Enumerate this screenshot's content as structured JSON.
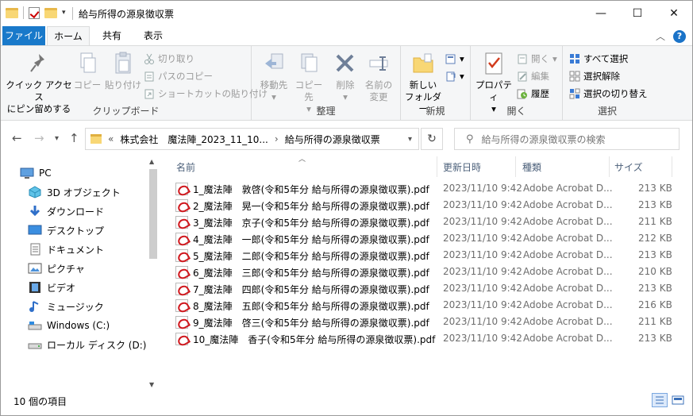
{
  "window": {
    "title": "給与所得の源泉徴収票",
    "minimize": "—",
    "maximize": "☐",
    "close": "✕"
  },
  "tabs": {
    "file": "ファイル",
    "home": "ホーム",
    "share": "共有",
    "view": "表示",
    "help": "?"
  },
  "ribbon": {
    "clipboard": {
      "label": "クリップボード",
      "pin": "クイック アクセス\nにピン留めする",
      "copy": "コピー",
      "paste": "貼り付け",
      "cut": "切り取り",
      "copy_path": "パスのコピー",
      "paste_shortcut": "ショートカットの貼り付け"
    },
    "organize": {
      "label": "整理",
      "move_to": "移動先",
      "copy_to": "コピー先",
      "delete": "削除",
      "rename": "名前の\n変更"
    },
    "new": {
      "label": "新規",
      "new_folder": "新しい\nフォルダー"
    },
    "open": {
      "label": "開く",
      "properties": "プロパティ",
      "open": "開く",
      "edit": "編集",
      "history": "履歴"
    },
    "select": {
      "label": "選択",
      "select_all": "すべて選択",
      "select_none": "選択解除",
      "invert": "選択の切り替え"
    }
  },
  "address": {
    "prefix": "«",
    "crumb1": "株式会社　魔法陣_2023_11_10...",
    "sep": "›",
    "crumb2": "給与所得の源泉徴収票",
    "search_placeholder": "給与所得の源泉徴収票の検索"
  },
  "nav": [
    {
      "label": "PC",
      "icon": "pc-icon",
      "indent": 0
    },
    {
      "label": "3D オブジェクト",
      "icon": "3d-objects-icon",
      "indent": 1
    },
    {
      "label": "ダウンロード",
      "icon": "download-icon",
      "indent": 1
    },
    {
      "label": "デスクトップ",
      "icon": "desktop-icon",
      "indent": 1
    },
    {
      "label": "ドキュメント",
      "icon": "documents-icon",
      "indent": 1
    },
    {
      "label": "ピクチャ",
      "icon": "pictures-icon",
      "indent": 1
    },
    {
      "label": "ビデオ",
      "icon": "video-icon",
      "indent": 1
    },
    {
      "label": "ミュージック",
      "icon": "music-icon",
      "indent": 1
    },
    {
      "label": "Windows (C:)",
      "icon": "drive-c-icon",
      "indent": 1
    },
    {
      "label": "ローカル ディスク (D:)",
      "icon": "drive-d-icon",
      "indent": 1
    }
  ],
  "columns": {
    "name": "名前",
    "date": "更新日時",
    "type": "種類",
    "size": "サイズ"
  },
  "files": [
    {
      "name": "1_魔法陣　敦啓(令和5年分 給与所得の源泉徴収票).pdf",
      "date": "2023/11/10 9:42",
      "type": "Adobe Acrobat D...",
      "size": "213 KB"
    },
    {
      "name": "2_魔法陣　晃一(令和5年分 給与所得の源泉徴収票).pdf",
      "date": "2023/11/10 9:42",
      "type": "Adobe Acrobat D...",
      "size": "213 KB"
    },
    {
      "name": "3_魔法陣　京子(令和5年分 給与所得の源泉徴収票).pdf",
      "date": "2023/11/10 9:42",
      "type": "Adobe Acrobat D...",
      "size": "211 KB"
    },
    {
      "name": "4_魔法陣　一郎(令和5年分 給与所得の源泉徴収票).pdf",
      "date": "2023/11/10 9:42",
      "type": "Adobe Acrobat D...",
      "size": "212 KB"
    },
    {
      "name": "5_魔法陣　二郎(令和5年分 給与所得の源泉徴収票).pdf",
      "date": "2023/11/10 9:42",
      "type": "Adobe Acrobat D...",
      "size": "213 KB"
    },
    {
      "name": "6_魔法陣　三郎(令和5年分 給与所得の源泉徴収票).pdf",
      "date": "2023/11/10 9:42",
      "type": "Adobe Acrobat D...",
      "size": "210 KB"
    },
    {
      "name": "7_魔法陣　四郎(令和5年分 給与所得の源泉徴収票).pdf",
      "date": "2023/11/10 9:42",
      "type": "Adobe Acrobat D...",
      "size": "213 KB"
    },
    {
      "name": "8_魔法陣　五郎(令和5年分 給与所得の源泉徴収票).pdf",
      "date": "2023/11/10 9:42",
      "type": "Adobe Acrobat D...",
      "size": "216 KB"
    },
    {
      "name": "9_魔法陣　啓三(令和5年分 給与所得の源泉徴収票).pdf",
      "date": "2023/11/10 9:42",
      "type": "Adobe Acrobat D...",
      "size": "211 KB"
    },
    {
      "name": "10_魔法陣　香子(令和5年分 給与所得の源泉徴収票).pdf",
      "date": "2023/11/10 9:42",
      "type": "Adobe Acrobat D...",
      "size": "213 KB"
    }
  ],
  "status": {
    "count": "10 個の項目"
  },
  "colors": {
    "accent": "#1979ca",
    "pdf_red": "#d0181e",
    "header_text": "#4c607a",
    "disabled": "#9a9a9a"
  }
}
